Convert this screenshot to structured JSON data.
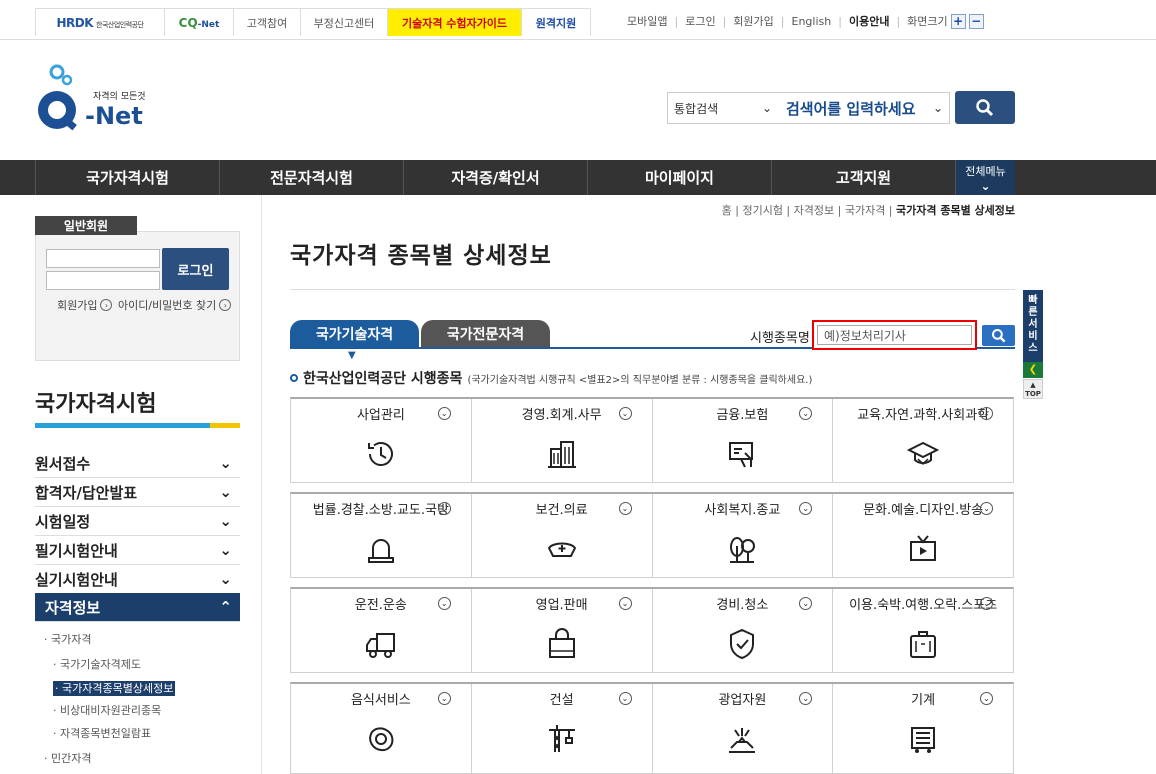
{
  "topbar": {
    "hrdk_logo": "HRDK",
    "hrdk_sub": "한국산업인력공단",
    "cq_logo": "CQ",
    "cq_net": "-Net",
    "links": [
      "고객참여",
      "부정신고센터"
    ],
    "guide_label": "기술자격 수험자가이드",
    "remote_label": "원격지원",
    "util": [
      "모바일앱",
      "로그인",
      "회원가입",
      "English",
      "이용안내",
      "화면크기"
    ],
    "zoom_in": "+",
    "zoom_out": "−"
  },
  "header": {
    "logo_tagline": "자격의 모든것",
    "logo_q": "Q",
    "logo_net": "-Net",
    "search_type": "통합검색",
    "search_placeholder": "검색어를 입력하세요"
  },
  "gnb": {
    "items": [
      "국가자격시험",
      "전문자격시험",
      "자격증/확인서",
      "마이페이지",
      "고객지원"
    ],
    "all_menu": "전체메뉴"
  },
  "login": {
    "member_type": "일반회원",
    "login_button": "로그인",
    "join": "회원가입",
    "find": "아이디/비밀번호 찾기"
  },
  "sidebar": {
    "title": "국가자격시험",
    "items": [
      "원서접수",
      "합격자/답안발표",
      "시험일정",
      "필기시험안내",
      "실기시험안내",
      "자격정보"
    ],
    "sub": [
      "· 국가자격",
      "· 국가기술자격제도",
      "· 국가자격종목별상세정보",
      "· 비상대비자원관리종목",
      "· 자격종목변천일람표",
      "· 민간자격"
    ]
  },
  "main": {
    "breadcrumb": [
      "홈",
      "정기시험",
      "자격정보",
      "국가자격",
      "국가자격 종목별 상세정보"
    ],
    "title": "국가자격 종목별 상세정보",
    "tabs": [
      "국가기술자격",
      "국가전문자격"
    ],
    "exam_label": "시행종목명",
    "exam_placeholder": "예)정보처리기사",
    "section_title": "한국산업인력공단 시행종목",
    "section_note": "(국가기술자격법 시행규칙 <별표2>의 직무분야별 분류 : 시행종목을 클릭하세요.)",
    "categories": [
      [
        "사업관리",
        "경영.회계.사무",
        "금융.보험",
        "교육.자연.과학.사회과학"
      ],
      [
        "법률.경찰.소방.교도.국방",
        "보건.의료",
        "사회복지.종교",
        "문화.예술.디자인.방송"
      ],
      [
        "운전.운송",
        "영업.판매",
        "경비.청소",
        "이용.숙박.여행.오락.스포츠"
      ],
      [
        "음식서비스",
        "건설",
        "광업자원",
        "기계"
      ]
    ]
  },
  "quick": {
    "label": "빠른서비스",
    "top": "TOP"
  },
  "colors": {
    "navy": "#1c3e6b",
    "gnb": "#333333",
    "highlight": "#ffee00",
    "red_box": "#ee0000",
    "tab_active": "#1c5c9c"
  }
}
